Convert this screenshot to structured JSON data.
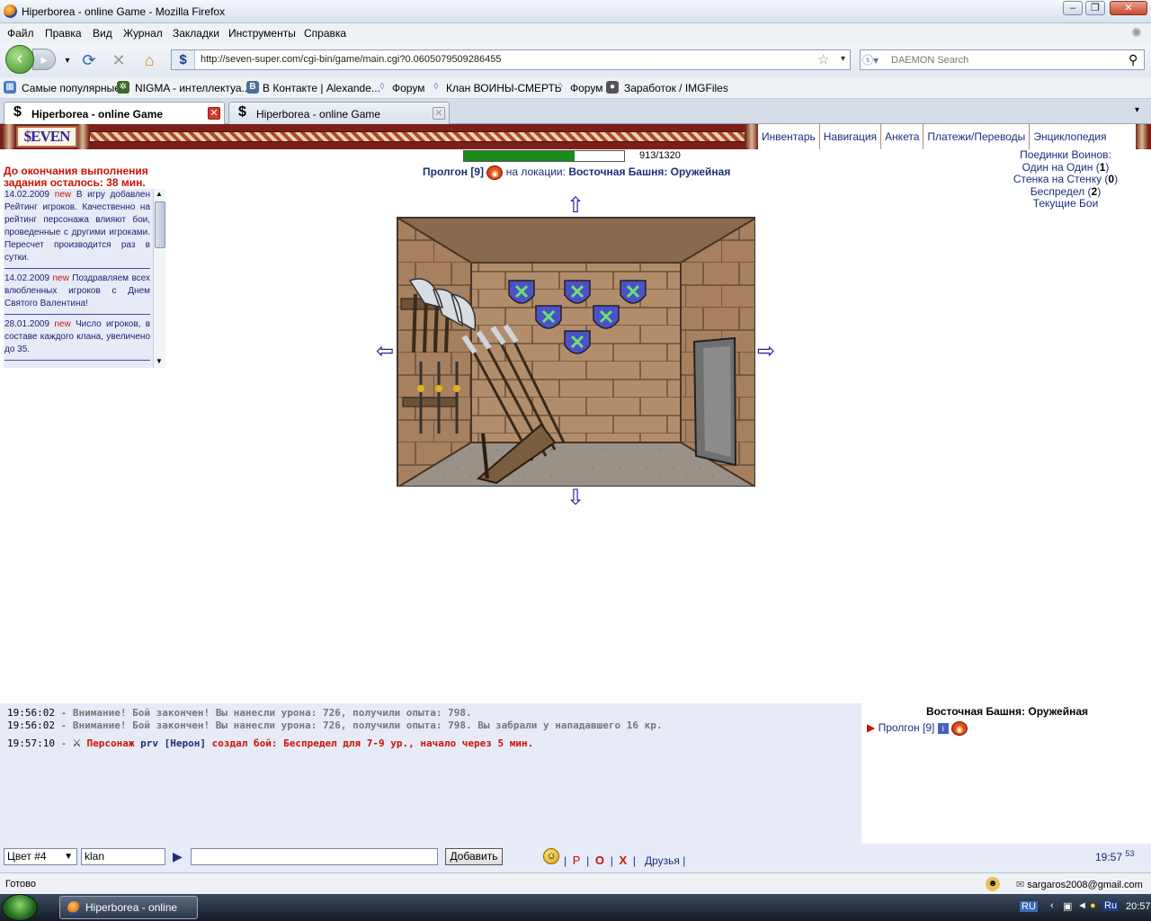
{
  "window": {
    "title": "Hiperborea - online Game - Mozilla Firefox"
  },
  "menu": [
    "Файл",
    "Правка",
    "Вид",
    "Журнал",
    "Закладки",
    "Инструменты",
    "Справка"
  ],
  "address": {
    "url": "http://seven-super.com/cgi-bin/game/main.cgi?0.0605079509286455",
    "site_glyph": "$"
  },
  "search": {
    "placeholder": "DAEMON Search"
  },
  "bookmarks": [
    "Самые популярные",
    "NIGMA - интеллектуа...",
    "В Контакте | Alexande...",
    "Форум",
    "Клан ВОИНЫ-СМЕРТЬ",
    "Форум",
    "Заработок / IMGFiles"
  ],
  "tabs": [
    {
      "label": "Hiperborea - online Game",
      "active": true
    },
    {
      "label": "Hiperborea - online Game",
      "active": false
    }
  ],
  "game": {
    "logo": "$EVEN",
    "menu": [
      "Инвентарь",
      "Навигация",
      "Анкета",
      "Платежи/Переводы",
      "Энциклопедия"
    ],
    "hp": {
      "current": 913,
      "max": 1320,
      "text": "913/1320"
    },
    "character": {
      "name": "Пролгон [9]",
      "location_prefix": "на локации:",
      "location": "Восточная Башня: Оружейная"
    },
    "alert": "До окончания выполнения задания осталось: 38 мин.",
    "news": [
      {
        "date": "14.02.2009",
        "tag": "new",
        "text": "В игру добавлен Рейтинг игроков. Качественно на рейтинг персонажа влияют бои, проведенные с другими игроками. Пересчет производится раз в сутки."
      },
      {
        "date": "14.02.2009",
        "tag": "new",
        "text": "Поздравляем всех влюбленных игроков с Днем Святого Валентина!"
      },
      {
        "date": "28.01.2009",
        "tag": "new",
        "text": "Число игроков, в составе каждого клана, увеличено до 35."
      }
    ],
    "duels": {
      "title": "Поединки Воинов:",
      "items": [
        {
          "label": "Один на Один",
          "count": "1"
        },
        {
          "label": "Стенка на Стенку",
          "count": "0"
        },
        {
          "label": "Беспредел",
          "count": "2"
        }
      ],
      "current": "Текущие Бои"
    },
    "chat": [
      {
        "time": "19:56:02",
        "text": "Внимание! Бой закончен! Вы нанесли урона: 726, получили опыта: 798."
      },
      {
        "time": "19:56:02",
        "text": "Внимание! Бой закончен! Вы нанесли урона: 726, получили опыта: 798. Вы забрали у нападавшего 16 кр."
      },
      {
        "time": "19:57:10",
        "who_prefix": "Персонаж",
        "who": "prv [Нерон]",
        "text": "создал бой: Беспредел для 7-9 ур., начало через 5 мин."
      }
    ],
    "online": {
      "location": "Восточная Башня: Оружейная",
      "player": "Пролгон [9]"
    },
    "input": {
      "color_select": "Цвет #4",
      "channel": "klan",
      "message": "",
      "add_label": "Добавить",
      "friends_label": "Друзья",
      "r_label": "Р",
      "o_label": "О",
      "x_label": "Х",
      "clock": "19:57",
      "clock_sec": "53"
    }
  },
  "status": {
    "text": "Готово",
    "email": "sargaros2008@gmail.com"
  },
  "taskbar": {
    "item": "Hiperborea - online Ga...",
    "lang1": "RU",
    "lang2": "Ru",
    "time": "20:57"
  },
  "colors": {
    "accent_red": "#cc1100",
    "link_blue": "#1a2e7a",
    "hp_green": "#1a8a1a",
    "chat_bg": "#e7ebf8",
    "header_maroon": "#7c1f1b"
  }
}
